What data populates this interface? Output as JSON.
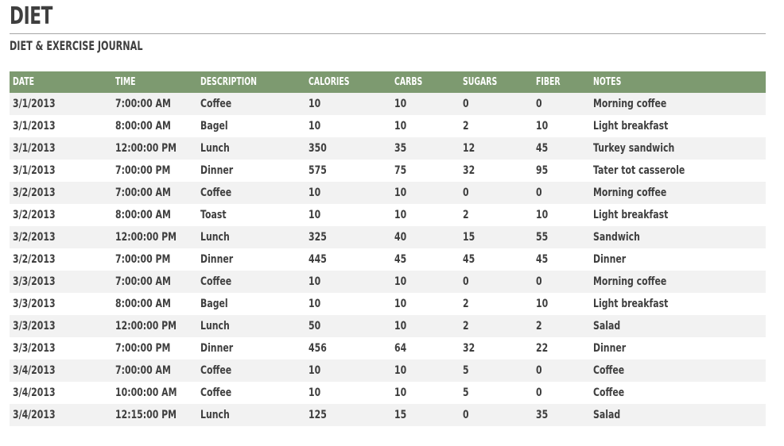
{
  "document": {
    "title": "DIET",
    "subtitle": "DIET & EXERCISE JOURNAL"
  },
  "colors": {
    "header_background": "#7d9a70",
    "header_text": "#ffffff",
    "body_text": "#3f3f3f",
    "row_odd_background": "#f2f2f2",
    "row_even_background": "#ffffff",
    "rule": "#a6a6a6"
  },
  "table": {
    "columns": [
      {
        "key": "date",
        "label": "DATE"
      },
      {
        "key": "time",
        "label": "TIME"
      },
      {
        "key": "description",
        "label": "DESCRIPTION"
      },
      {
        "key": "calories",
        "label": "CALORIES"
      },
      {
        "key": "carbs",
        "label": "CARBS"
      },
      {
        "key": "sugars",
        "label": "SUGARS"
      },
      {
        "key": "fiber",
        "label": "FIBER"
      },
      {
        "key": "notes",
        "label": "NOTES"
      }
    ],
    "rows": [
      {
        "date": "3/1/2013",
        "time": "7:00:00 AM",
        "description": "Coffee",
        "calories": "10",
        "carbs": "10",
        "sugars": "0",
        "fiber": "0",
        "notes": "Morning coffee"
      },
      {
        "date": "3/1/2013",
        "time": "8:00:00 AM",
        "description": "Bagel",
        "calories": "10",
        "carbs": "10",
        "sugars": "2",
        "fiber": "10",
        "notes": "Light breakfast"
      },
      {
        "date": "3/1/2013",
        "time": "12:00:00 PM",
        "description": "Lunch",
        "calories": "350",
        "carbs": "35",
        "sugars": "12",
        "fiber": "45",
        "notes": "Turkey sandwich"
      },
      {
        "date": "3/1/2013",
        "time": "7:00:00 PM",
        "description": "Dinner",
        "calories": "575",
        "carbs": "75",
        "sugars": "32",
        "fiber": "95",
        "notes": "Tater tot casserole"
      },
      {
        "date": "3/2/2013",
        "time": "7:00:00 AM",
        "description": "Coffee",
        "calories": "10",
        "carbs": "10",
        "sugars": "0",
        "fiber": "0",
        "notes": "Morning coffee"
      },
      {
        "date": "3/2/2013",
        "time": "8:00:00 AM",
        "description": "Toast",
        "calories": "10",
        "carbs": "10",
        "sugars": "2",
        "fiber": "10",
        "notes": "Light breakfast"
      },
      {
        "date": "3/2/2013",
        "time": "12:00:00 PM",
        "description": "Lunch",
        "calories": "325",
        "carbs": "40",
        "sugars": "15",
        "fiber": "55",
        "notes": "Sandwich"
      },
      {
        "date": "3/2/2013",
        "time": "7:00:00 PM",
        "description": "Dinner",
        "calories": "445",
        "carbs": "45",
        "sugars": "45",
        "fiber": "45",
        "notes": "Dinner"
      },
      {
        "date": "3/3/2013",
        "time": "7:00:00 AM",
        "description": "Coffee",
        "calories": "10",
        "carbs": "10",
        "sugars": "0",
        "fiber": "0",
        "notes": "Morning coffee"
      },
      {
        "date": "3/3/2013",
        "time": "8:00:00 AM",
        "description": "Bagel",
        "calories": "10",
        "carbs": "10",
        "sugars": "2",
        "fiber": "10",
        "notes": "Light breakfast"
      },
      {
        "date": "3/3/2013",
        "time": "12:00:00 PM",
        "description": "Lunch",
        "calories": "50",
        "carbs": "10",
        "sugars": "2",
        "fiber": "2",
        "notes": "Salad"
      },
      {
        "date": "3/3/2013",
        "time": "7:00:00 PM",
        "description": "Dinner",
        "calories": "456",
        "carbs": "64",
        "sugars": "32",
        "fiber": "22",
        "notes": "Dinner"
      },
      {
        "date": "3/4/2013",
        "time": "7:00:00 AM",
        "description": "Coffee",
        "calories": "10",
        "carbs": "10",
        "sugars": "5",
        "fiber": "0",
        "notes": "Coffee"
      },
      {
        "date": "3/4/2013",
        "time": "10:00:00 AM",
        "description": "Coffee",
        "calories": "10",
        "carbs": "10",
        "sugars": "5",
        "fiber": "0",
        "notes": "Coffee"
      },
      {
        "date": "3/4/2013",
        "time": "12:15:00 PM",
        "description": "Lunch",
        "calories": "125",
        "carbs": "15",
        "sugars": "0",
        "fiber": "35",
        "notes": "Salad"
      }
    ]
  }
}
